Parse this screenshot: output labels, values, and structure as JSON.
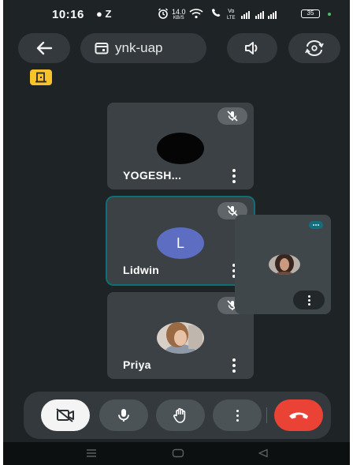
{
  "status_bar": {
    "time": "10:16",
    "left_icons": "● Z",
    "net_speed_top": "14.0",
    "net_speed_bottom": "KB/S",
    "lte_top": "Vo",
    "lte_bottom": "LTE",
    "battery": "35"
  },
  "top_bar": {
    "back_icon": "arrow-left-icon",
    "meeting_code": "ynk-uap",
    "calendar_icon": "calendar-icon",
    "audio_icon": "speaker-icon",
    "flip_icon": "camera-flip-icon"
  },
  "badge_icon": "door-exit-icon",
  "participants": [
    {
      "name": "YOGESH...",
      "avatar": "black-circle",
      "muted": true,
      "active": false
    },
    {
      "name": "Lidwin",
      "avatar_letter": "L",
      "muted": true,
      "active": true
    },
    {
      "name": "Priya",
      "avatar": "photo",
      "muted": true,
      "active": false
    }
  ],
  "self_view": {
    "avatar": "photo"
  },
  "controls": {
    "camera": "camera-off-icon",
    "mic": "mic-icon",
    "hand": "raise-hand-icon",
    "more": "more-vertical-icon",
    "end_call": "hang-up-icon"
  },
  "colors": {
    "background": "#1e2325",
    "tile": "#3b4144",
    "active_border": "#0e6f75",
    "end_call": "#ea4335",
    "badge": "#f7c22a",
    "avatar_l": "#5d6ec2"
  }
}
